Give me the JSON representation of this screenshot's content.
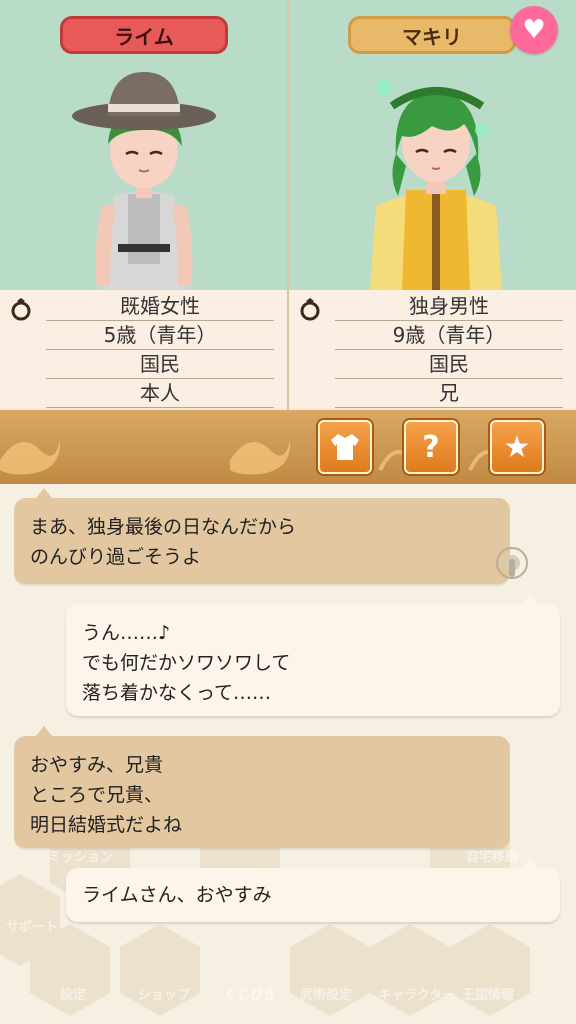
{
  "characters": {
    "left": {
      "name": "ライム",
      "rows": [
        "既婚女性",
        "5歳（青年）",
        "国民",
        "本人"
      ]
    },
    "right": {
      "name": "マキリ",
      "rows": [
        "独身男性",
        "9歳（青年）",
        "国民",
        "兄"
      ]
    }
  },
  "toolbar": {
    "buttons": [
      {
        "icon": "clothes-icon",
        "label": ""
      },
      {
        "icon": "question-icon",
        "label": "?"
      },
      {
        "icon": "star-icon",
        "label": "★"
      }
    ]
  },
  "messages": [
    {
      "side": "left",
      "lines": [
        "まあ、独身最後の日なんだから",
        "のんびり過ごそうよ"
      ]
    },
    {
      "side": "right",
      "lines": [
        "うん……♪",
        "でも何だかソワソワして",
        "落ち着かなくって……"
      ]
    },
    {
      "side": "left",
      "lines": [
        "おやすみ、兄貴",
        "ところで兄貴、",
        "明日結婚式だよね"
      ]
    },
    {
      "side": "right",
      "lines": [
        "ライムさん、おやすみ"
      ]
    }
  ],
  "background_menu": {
    "labels": [
      "ミッション",
      "自宅移動",
      "サポート",
      "設定",
      "ショップ",
      "くじびき",
      "武術設定",
      "キャラクター",
      "王国情報"
    ]
  },
  "colors": {
    "portrait_bg": "#b9dcc8",
    "left_name_tag": "#e85a5a",
    "right_name_tag": "#e9b96a",
    "heart_button": "#ff6a9a",
    "toolbar_button": "#e07a1c"
  }
}
